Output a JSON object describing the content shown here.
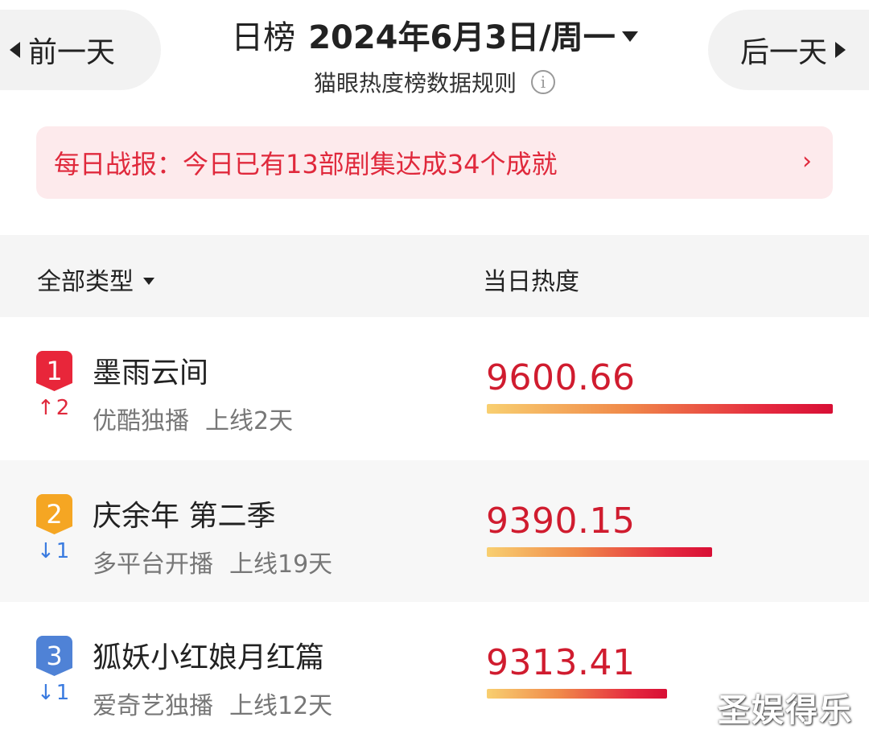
{
  "header": {
    "prev_label": "前一天",
    "next_label": "后一天",
    "title_prefix": "日榜",
    "date_label": "2024年6月3日/周一",
    "rules_label": "猫眼热度榜数据规则",
    "info_icon": "info-icon"
  },
  "banner": {
    "text": "每日战报：今日已有13部剧集达成34个成就",
    "chevron": "›"
  },
  "table": {
    "type_filter_label": "全部类型",
    "heat_column_label": "当日热度"
  },
  "rows": [
    {
      "rank": "1",
      "badge_color": "#e8263a",
      "change_dir": "up",
      "change_arrow": "↑",
      "change_value": "2",
      "change_color": "#e0293c",
      "title": "墨雨云间",
      "platform": "优酷独播",
      "online": "上线2天",
      "heat": "9600.66",
      "heat_value": 9600.66
    },
    {
      "rank": "2",
      "badge_color": "#f5a623",
      "change_dir": "down",
      "change_arrow": "↓",
      "change_value": "1",
      "change_color": "#3a7be0",
      "title": "庆余年 第二季",
      "platform": "多平台开播",
      "online": "上线19天",
      "heat": "9390.15",
      "heat_value": 9390.15
    },
    {
      "rank": "3",
      "badge_color": "#4f82d6",
      "change_dir": "down",
      "change_arrow": "↓",
      "change_value": "1",
      "change_color": "#3a7be0",
      "title": "狐妖小红娘月红篇",
      "platform": "爱奇艺独播",
      "online": "上线12天",
      "heat": "9313.41",
      "heat_value": 9313.41
    }
  ],
  "watermark": "圣娱得乐"
}
